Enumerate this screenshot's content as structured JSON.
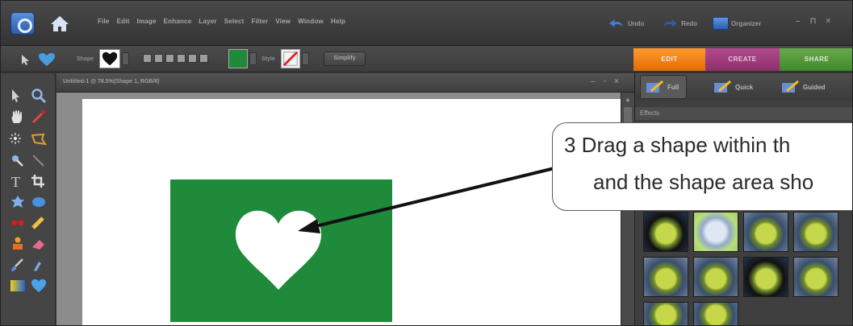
{
  "menubar": {
    "menus": [
      "File",
      "Edit",
      "Image",
      "Enhance",
      "Layer",
      "Select",
      "Filter",
      "View",
      "Window",
      "Help"
    ],
    "undo": "Undo",
    "redo": "Redo",
    "organizer": "Organizer",
    "window_controls": [
      "–",
      "⊓",
      "×"
    ]
  },
  "optbar": {
    "shape_label": "Shape",
    "style_label": "Style",
    "simplify_label": "Simplify"
  },
  "mode_tabs": [
    "EDIT",
    "CREATE",
    "SHARE"
  ],
  "document": {
    "title": "Untitled-1 @ 78.5%(Shape 1, RGB/8)",
    "controls": [
      "–",
      "▫",
      "×"
    ],
    "shape_color": "#1e8a3a"
  },
  "right_panel": {
    "tabs": [
      "Full",
      "Quick",
      "Guided"
    ],
    "section": "Effects"
  },
  "callout": {
    "line1": "3  Drag a shape within th",
    "line2": "and the shape area sho"
  },
  "colors": {
    "edit_tab": "#f08214",
    "create_tab": "#a03c7e",
    "share_tab": "#5a9c3c"
  }
}
